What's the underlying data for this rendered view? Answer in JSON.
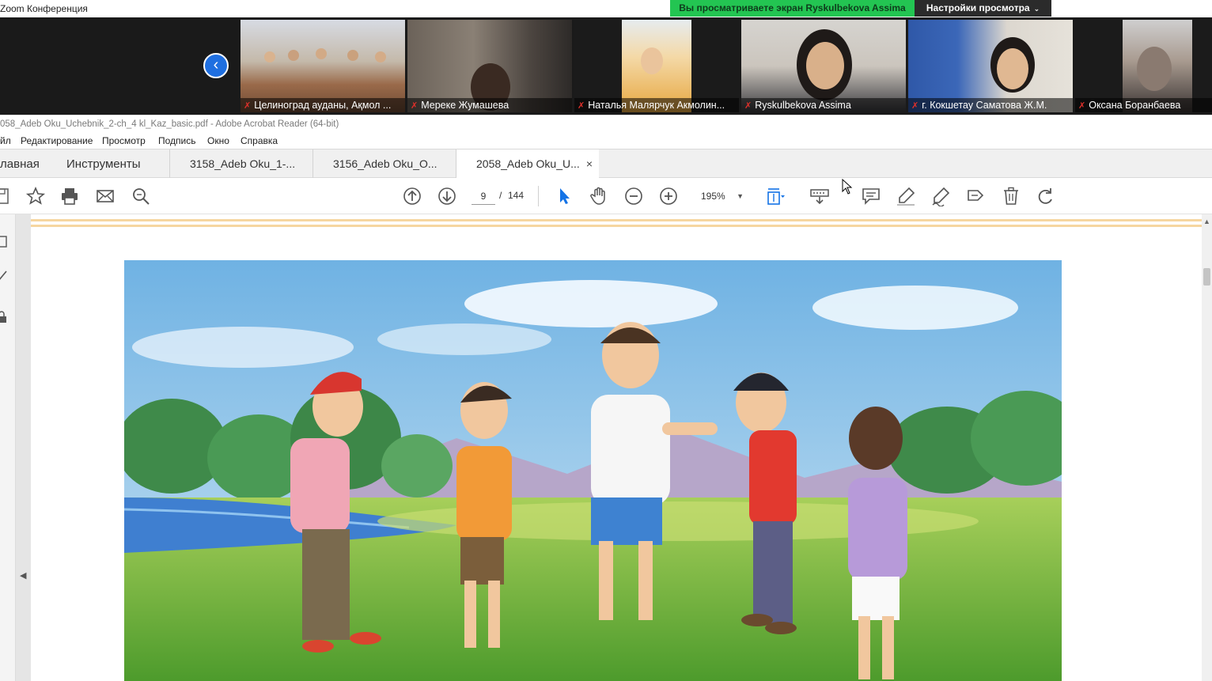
{
  "zoom": {
    "window_title": "Zoom Конференция",
    "share_banner": "Вы просматриваете экран Ryskulbekova Assima",
    "view_settings": "Настройки просмотра",
    "participants": [
      {
        "name": "Целиноград  ауданы, Ақмол ..."
      },
      {
        "name": "Мереке Жумашева"
      },
      {
        "name": "Наталья Малярчук Акмолин..."
      },
      {
        "name": "Ryskulbekova Assima"
      },
      {
        "name": "г. Кокшетау Саматова Ж.М."
      },
      {
        "name": "Оксана Боранбаева"
      }
    ],
    "colors": {
      "banner": "#23c552",
      "nav": "#1f6fe0",
      "muted_mic": "#e0302a"
    }
  },
  "acrobat": {
    "title": "058_Adeb Oku_Uchebnik_2-ch_4 kl_Kaz_basic.pdf - Adobe Acrobat Reader (64-bit)",
    "menu": [
      "йл",
      "Редактирование",
      "Просмотр",
      "Подпись",
      "Окно",
      "Справка"
    ],
    "tabs": {
      "home": "лавная",
      "tools": "Инструменты",
      "docs": [
        {
          "label": "3158_Adeb Oku_1-..."
        },
        {
          "label": "3156_Adeb Oku_O..."
        },
        {
          "label": "2058_Adeb Oku_U...",
          "close": "×"
        }
      ]
    },
    "toolbar": {
      "page_current": "9",
      "page_sep": "/",
      "page_total": "144",
      "zoom": "195%",
      "icons": [
        "save-icon",
        "star-icon",
        "print-icon",
        "email-icon",
        "search-icon",
        "page-up-icon",
        "page-down-icon",
        "select-arrow-icon",
        "hand-icon",
        "zoom-out-icon",
        "zoom-in-icon",
        "fit-page-icon",
        "keyboard-icon",
        "comment-icon",
        "highlight-icon",
        "sign-icon",
        "share-icon",
        "delete-icon",
        "undo-icon"
      ],
      "accent": "#1473e6"
    }
  }
}
